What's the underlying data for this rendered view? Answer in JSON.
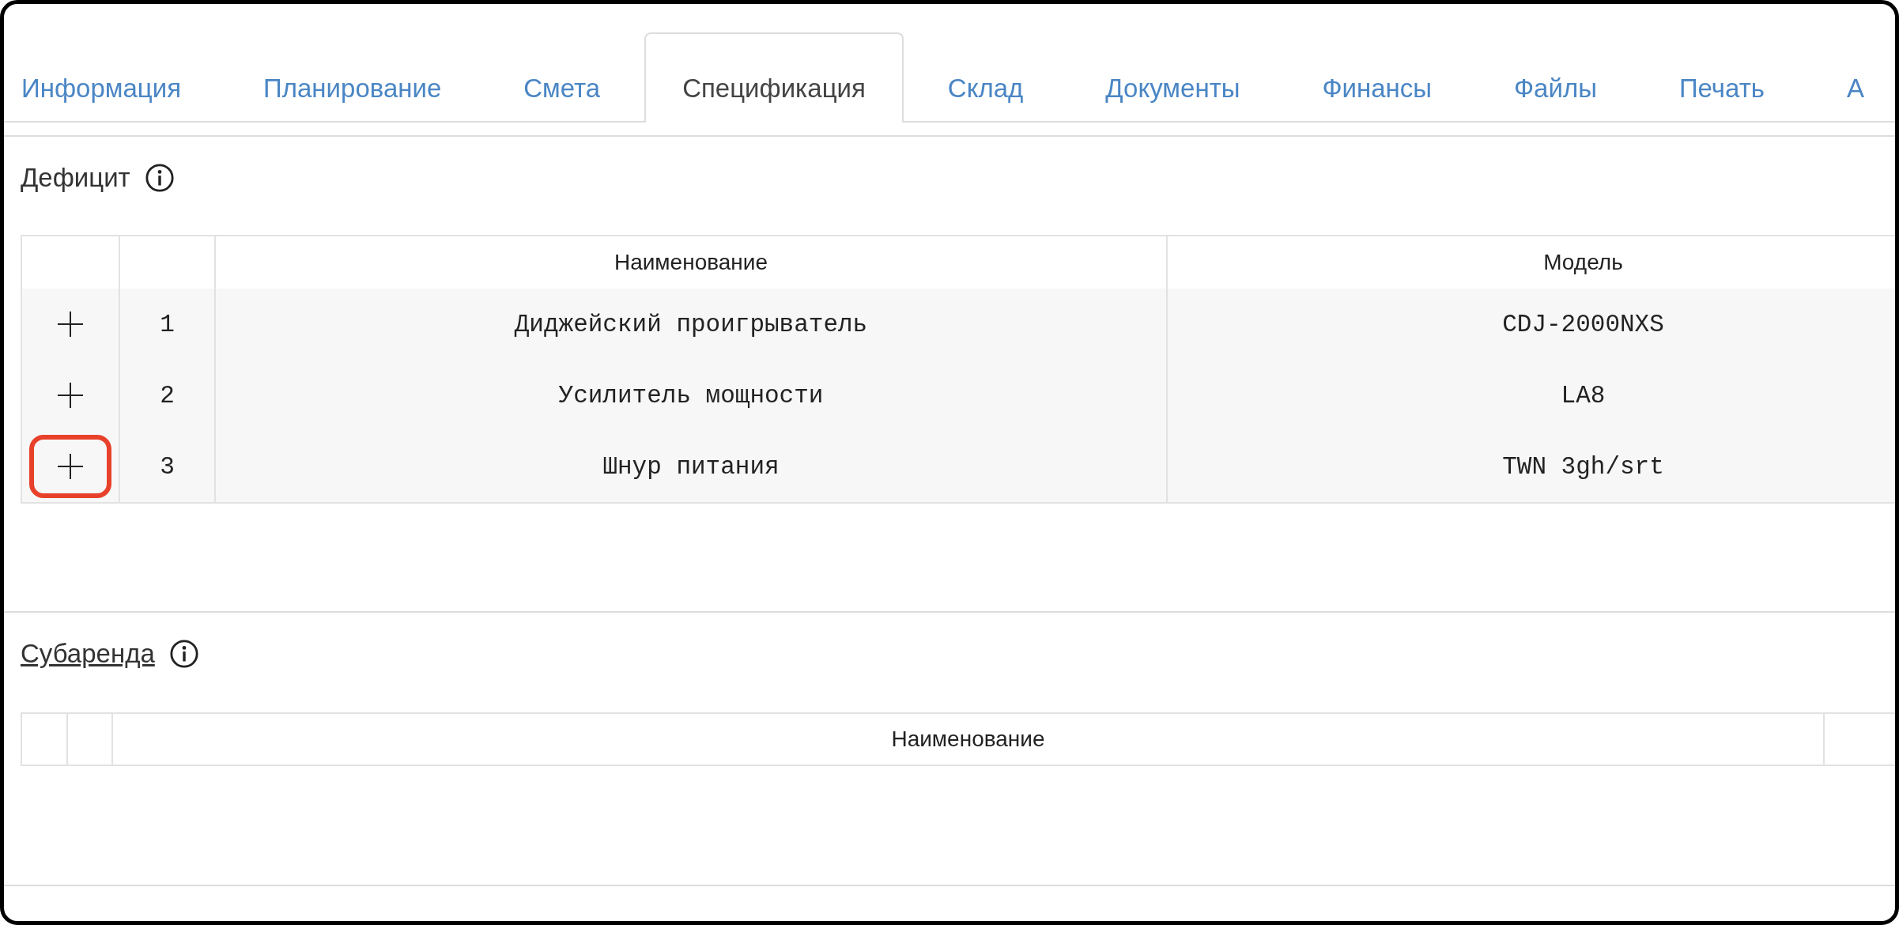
{
  "tabs": [
    {
      "label": "Информация",
      "selected": false
    },
    {
      "label": "Планирование",
      "selected": false
    },
    {
      "label": "Смета",
      "selected": false
    },
    {
      "label": "Спецификация",
      "selected": true
    },
    {
      "label": "Склад",
      "selected": false
    },
    {
      "label": "Документы",
      "selected": false
    },
    {
      "label": "Финансы",
      "selected": false
    },
    {
      "label": "Файлы",
      "selected": false
    },
    {
      "label": "Печать",
      "selected": false
    },
    {
      "label": "А",
      "selected": false
    }
  ],
  "deficit": {
    "title": "Дефицит",
    "columns": [
      "Наименование",
      "Модель"
    ],
    "rows": [
      {
        "number": "1",
        "name": "Диджейский проигрыватель",
        "model": "CDJ-2000NXS",
        "highlighted": false
      },
      {
        "number": "2",
        "name": "Усилитель мощности",
        "model": "LA8",
        "highlighted": false
      },
      {
        "number": "3",
        "name": "Шнур питания",
        "model": "TWN 3gh/srt",
        "highlighted": true
      }
    ]
  },
  "subrent": {
    "title": "Субаренда",
    "columns": [
      "Наименование"
    ]
  }
}
